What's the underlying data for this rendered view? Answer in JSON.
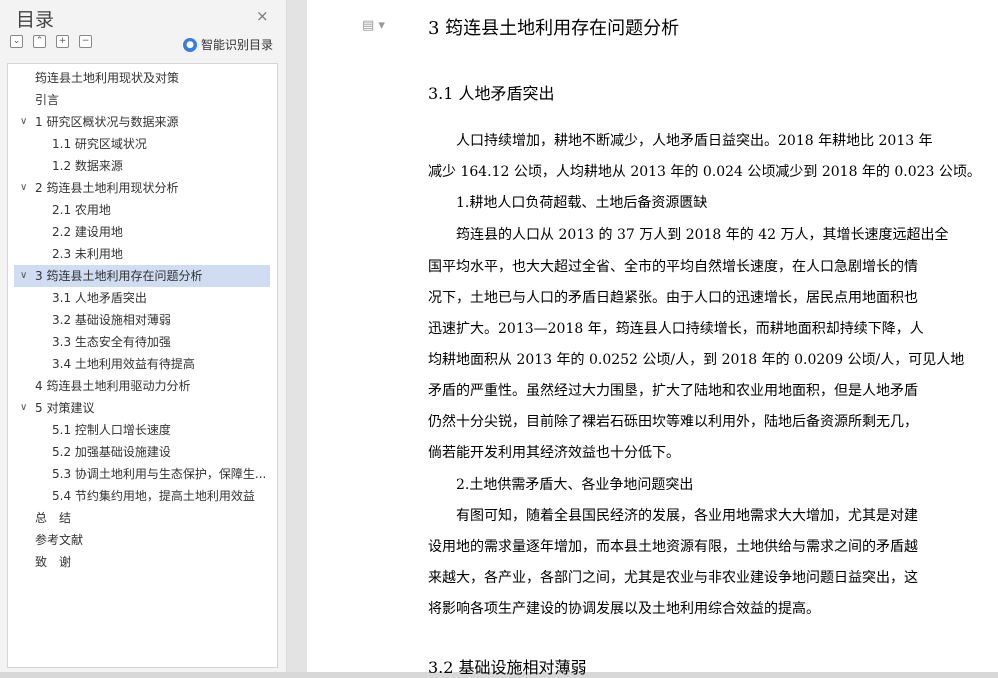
{
  "sidebar": {
    "title": "目录",
    "close_glyph": "×",
    "smart_toc_label": "智能识别目录",
    "tools": [
      "expand-all-icon",
      "collapse-all-icon",
      "add-heading-icon",
      "remove-heading-icon"
    ],
    "items": [
      {
        "label": "筠连县土地利用现状及对策",
        "level": 0,
        "chevron": false
      },
      {
        "label": "引言",
        "level": 0,
        "chevron": false
      },
      {
        "label": "1 研究区概状况与数据来源",
        "level": 0,
        "chevron": true
      },
      {
        "label": "1.1 研究区域状况",
        "level": 1,
        "chevron": false
      },
      {
        "label": "1.2 数据来源",
        "level": 1,
        "chevron": false
      },
      {
        "label": "2 筠连县土地利用现状分析",
        "level": 0,
        "chevron": true
      },
      {
        "label": "2.1 农用地",
        "level": 1,
        "chevron": false
      },
      {
        "label": "2.2 建设用地",
        "level": 1,
        "chevron": false
      },
      {
        "label": "2.3 未利用地",
        "level": 1,
        "chevron": false
      },
      {
        "label": "3 筠连县土地利用存在问题分析",
        "level": 0,
        "chevron": true,
        "active": true
      },
      {
        "label": "3.1 人地矛盾突出",
        "level": 1,
        "chevron": false
      },
      {
        "label": "3.2 基础设施相对薄弱",
        "level": 1,
        "chevron": false
      },
      {
        "label": "3.3 生态安全有待加强",
        "level": 1,
        "chevron": false
      },
      {
        "label": "3.4 土地利用效益有待提高",
        "level": 1,
        "chevron": false
      },
      {
        "label": "4 筠连县土地利用驱动力分析",
        "level": 0,
        "chevron": false
      },
      {
        "label": "5 对策建议",
        "level": 0,
        "chevron": true
      },
      {
        "label": "5.1 控制人口增长速度",
        "level": 1,
        "chevron": false
      },
      {
        "label": "5.2 加强基础设施建设",
        "level": 1,
        "chevron": false
      },
      {
        "label": "5.3 协调土地利用与生态保护，保障生...",
        "level": 1,
        "chevron": false
      },
      {
        "label": "5.4 节约集约用地，提高土地利用效益",
        "level": 1,
        "chevron": false
      },
      {
        "label": "总　结",
        "level": 0,
        "chevron": false
      },
      {
        "label": "参考文献",
        "level": 0,
        "chevron": false
      },
      {
        "label": "致　谢",
        "level": 0,
        "chevron": false
      }
    ]
  },
  "document": {
    "heading": "3 筠连县土地利用存在问题分析",
    "subheading": "3.1 人地矛盾突出",
    "lines": [
      "　　人口持续增加，耕地不断减少，人地矛盾日益突出。2018 年耕地比 2013 年",
      "减少 164.12 公顷，人均耕地从 2013 年的 0.024 公顷减少到 2018 年的 0.023 公顷。",
      "　　1.耕地人口负荷超载、土地后备资源匮缺",
      "　　筠连县的人口从 2013 的 37 万人到 2018 年的 42 万人，其增长速度远超出全",
      "国平均水平，也大大超过全省、全市的平均自然增长速度，在人口急剧增长的情",
      "况下，土地已与人口的矛盾日趋紧张。由于人口的迅速增长，居民点用地面积也",
      "迅速扩大。2013—2018 年，筠连县人口持续增长，而耕地面积却持续下降，人",
      "均耕地面积从 2013 年的 0.0252 公顷/人，到 2018 年的 0.0209 公顷/人，可见人地",
      "矛盾的严重性。虽然经过大力围垦，扩大了陆地和农业用地面积，但是人地矛盾",
      "仍然十分尖锐，目前除了裸岩石砾田坎等难以利用外，陆地后备资源所剩无几，",
      "倘若能开发利用其经济效益也十分低下。",
      "　　2.土地供需矛盾大、各业争地问题突出",
      "　　有图可知，随着全县国民经济的发展，各业用地需求大大增加，尤其是对建",
      "设用地的需求量逐年增加，而本县土地资源有限，土地供给与需求之间的矛盾越",
      "来越大，各产业，各部门之间，尤其是农业与非农业建设争地问题日益突出，这",
      "将影响各项生产建设的协调发展以及土地利用综合效益的提高。"
    ],
    "next_heading": "3.2 基础设施相对薄弱"
  }
}
